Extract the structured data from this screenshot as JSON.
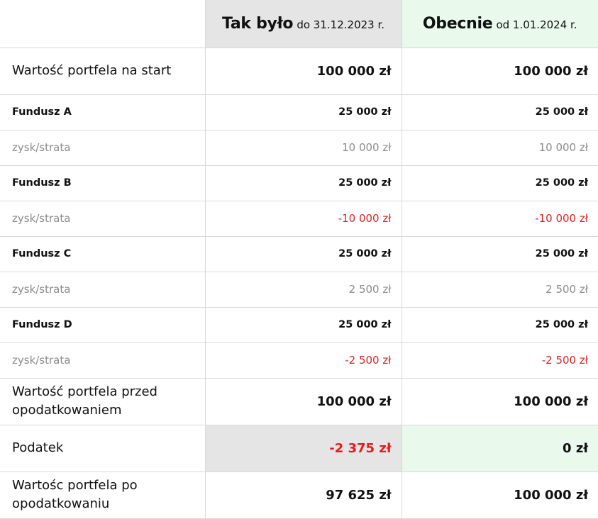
{
  "header": {
    "then": {
      "title": "Tak było",
      "subtitle": "do 31.12.2023 r."
    },
    "now": {
      "title": "Obecnie",
      "subtitle": "od 1.01.2024 r."
    }
  },
  "rows": {
    "start": {
      "label": "Wartość portfela na start",
      "then": "100 000 zł",
      "now": "100 000 zł"
    },
    "fund_a": {
      "label": "Fundusz A",
      "then": "25 000 zł",
      "now": "25 000 zł"
    },
    "gain_a": {
      "label": "zysk/strata",
      "then": "10 000 zł",
      "now": "10 000 zł"
    },
    "fund_b": {
      "label": "Fundusz B",
      "then": "25 000 zł",
      "now": "25 000 zł"
    },
    "gain_b": {
      "label": "zysk/strata",
      "then": "-10 000 zł",
      "now": "-10 000 zł"
    },
    "fund_c": {
      "label": "Fundusz C",
      "then": "25 000 zł",
      "now": "25 000 zł"
    },
    "gain_c": {
      "label": "zysk/strata",
      "then": "2 500 zł",
      "now": "2 500 zł"
    },
    "fund_d": {
      "label": "Fundusz D",
      "then": "25 000 zł",
      "now": "25 000 zł"
    },
    "gain_d": {
      "label": "zysk/strata",
      "then": "-2 500 zł",
      "now": "-2 500 zł"
    },
    "before_tax": {
      "label": "Wartość portfela przed opodatkowaniem",
      "then": "100 000 zł",
      "now": "100 000 zł"
    },
    "tax": {
      "label": "Podatek",
      "then": "-2 375 zł",
      "now": "0 zł"
    },
    "after_tax": {
      "label": "Wartośc portfela po opodatkowaniu",
      "then": "97 625 zł",
      "now": "100 000 zł"
    }
  },
  "colors": {
    "then_bg": "#e5e5e5",
    "now_bg": "#e9f9ec",
    "negative": "#e32222",
    "muted": "#8c8c8c"
  }
}
